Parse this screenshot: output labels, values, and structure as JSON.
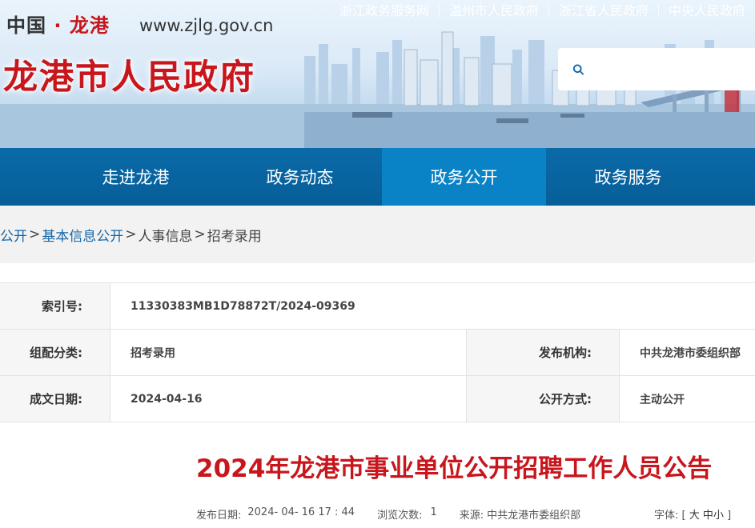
{
  "header": {
    "site_name_part1": "中国",
    "site_name_dot": " · ",
    "site_name_part2": "龙港",
    "site_url": "www.zjlg.gov.cn",
    "site_title": "龙港市人民政府",
    "top_links": [
      "浙江政务服务网",
      "温州市人民政府",
      "浙江省人民政府",
      "中央人民政府"
    ],
    "search_placeholder": ""
  },
  "nav": {
    "items": [
      "走进龙港",
      "政务动态",
      "政务公开",
      "政务服务"
    ],
    "active": "政务公开"
  },
  "breadcrumb": {
    "items": [
      "公开",
      "基本信息公开",
      "人事信息",
      "招考录用"
    ],
    "separator": ">"
  },
  "info": {
    "index_label": "索引号:",
    "index_value": "11330383MB1D78872T/2024-09369",
    "category_label": "组配分类:",
    "category_value": "招考录用",
    "publisher_label": "发布机构:",
    "publisher_value": "中共龙港市委组织部",
    "date_label": "成文日期:",
    "date_value": "2024-04-16",
    "mode_label": "公开方式:",
    "mode_value": "主动公开"
  },
  "article": {
    "title": "2024年龙港市事业单位公开招聘工作人员公告",
    "publish_label": "发布日期:",
    "publish_value": "2024- 04- 16 17 : 44",
    "views_label": "浏览次数:",
    "views_value": "1",
    "source_label": "来源:",
    "source_value": "中共龙港市委组织部",
    "font_label": "字体:",
    "font_open": "[",
    "font_large": "大",
    "font_medium": "中",
    "font_small": "小",
    "font_close": "]"
  },
  "colors": {
    "brand_red": "#c8161d",
    "nav_blue": "#075e98",
    "nav_active": "#0a82c6",
    "link_blue": "#1466a8"
  }
}
